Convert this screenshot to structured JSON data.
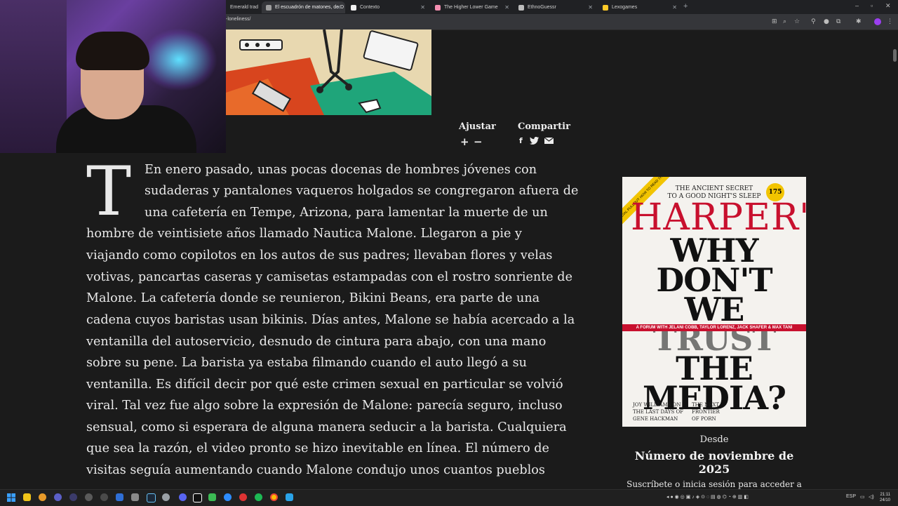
{
  "browser": {
    "tabs": [
      {
        "label": "Emerald trad",
        "color": "#4caf50"
      },
      {
        "label": "El escuadrón de matones, de D",
        "color": "#9e9e9e"
      },
      {
        "label": "Contexto",
        "color": "#f2f2f2"
      },
      {
        "label": "The Higher Lower Game",
        "color": "#f48fb1"
      },
      {
        "label": "EthnoGuessr",
        "color": "#bdbdbd"
      },
      {
        "label": "Lexogames",
        "color": "#ffca28"
      }
    ],
    "url": "-loneliness/"
  },
  "article": {
    "controls": {
      "adjust_label": "Ajustar",
      "share_label": "Compartir"
    },
    "dropcap": "T",
    "lines": [
      "En enero pasado, unas pocas docenas de hombres jóvenes con",
      "sudaderas y pantalones vaqueros holgados se congregaron afuera de",
      "una cafetería en Tempe, Arizona, para lamentar la muerte de un",
      "hombre de veintisiete años llamado Nautica Malone. Llegaron a pie y",
      "viajando como copilotos en los autos de sus padres; llevaban flores y velas",
      "votivas, pancartas caseras y camisetas estampadas con el rostro sonriente de",
      "Malone. La cafetería donde se reunieron, Bikini Beans, era parte de una",
      "cadena cuyos baristas usan bikinis. Días antes, Malone se había acercado a la",
      "ventanilla del autoservicio, desnudo de cintura para abajo, con una mano",
      "sobre su pene. La barista ya estaba filmando cuando el auto llegó a su",
      "ventanilla. Es difícil decir por qué este crimen sexual en particular se volvió",
      "viral. Tal vez fue algo sobre la expresión de Malone: parecía seguro, incluso",
      "sensual, como si esperara de alguna manera seducir a la barista. Cualquiera",
      "que sea la razón, el video pronto se hizo inevitable en línea. El número de",
      "visitas seguía aumentando cuando Malone condujo unos cuantos pueblos"
    ]
  },
  "sidebar": {
    "cover": {
      "tagline_1": "THE ANCIENT SECRET",
      "tagline_2": "TO A GOOD NIGHT'S SLEEP",
      "masthead": "HARPER'S",
      "badge": "175",
      "corner": "A SPECIAL PULLOUT: HOW TO READ THE NEWS",
      "headline_1": "WHY",
      "headline_2": "DON'T",
      "headline_3": "WE",
      "headline_4": "TRUST",
      "headline_5": "THE",
      "headline_6": "MEDIA?",
      "forum": "A FORUM WITH JELANI COBB, TAYLOR LORENZ, JACK SHAFER & MAX TANI",
      "foot_left_1": "JOY WILLIAMS ON",
      "foot_left_2": "THE LAST DAYS OF",
      "foot_left_3": "GENE HACKMAN",
      "foot_right_1": "THE NEXT",
      "foot_right_2": "FRONTIER",
      "foot_right_3": "OF PORN"
    },
    "desde": "Desde",
    "issue": "Número de noviembre de 2025",
    "subscribe": "Suscríbete o inicia sesión para acceder a este"
  },
  "taskbar": {
    "lang": "ESP",
    "time": "21:11",
    "date": "24/10"
  }
}
